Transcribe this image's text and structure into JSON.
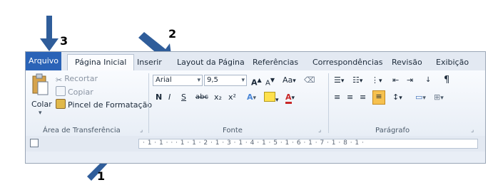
{
  "tabs": {
    "file": "Arquivo",
    "home": "Página Inicial",
    "insert": "Inserir",
    "layout": "Layout da Página",
    "references": "Referências",
    "mailings": "Correspondências",
    "review": "Revisão",
    "view": "Exibição"
  },
  "clipboard": {
    "paste": "Colar",
    "cut": "Recortar",
    "copy": "Copiar",
    "format_painter": "Pincel de Formatação",
    "group_label": "Área de Transferência"
  },
  "font": {
    "font_name": "Arial",
    "font_size": "9,5",
    "group_label": "Fonte",
    "bold": "N",
    "italic": "I",
    "underline": "S",
    "strike": "abc",
    "sub": "x₂",
    "sup": "x²",
    "grow": "A",
    "shrink": "A",
    "case": "Aa",
    "color": "A"
  },
  "paragraph": {
    "group_label": "Parágrafo",
    "pilcrow": "¶"
  },
  "ruler": {
    "text": "· 1 · 1 ·   ·   · 1 · 1 · 2 · 1 · 3 · 1 · 4 · 1 · 5 · 1 · 6 · 1 · 7 · 1 · 8 · 1 ·"
  },
  "annotations": {
    "n1": "1",
    "n2": "2",
    "n3": "3"
  },
  "colors": {
    "file_tab": "#2a63b7",
    "arrow": "#2f5d9a"
  }
}
